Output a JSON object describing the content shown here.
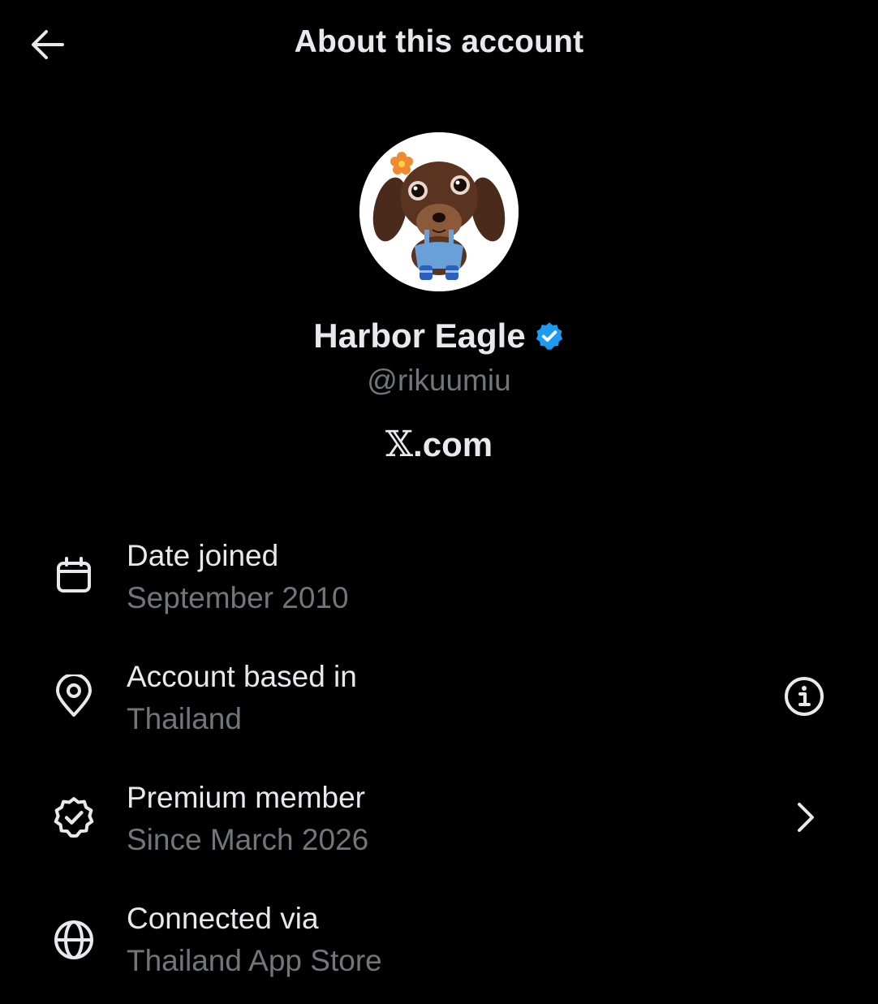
{
  "header": {
    "title": "About this account",
    "back_icon": "arrow-left-icon"
  },
  "profile": {
    "display_name": "Harbor Eagle",
    "verified_icon": "verified-badge-icon",
    "verified_color": "#1d9bf0",
    "handle": "@rikuumiu",
    "domain_letter": "𝕏",
    "domain_suffix": ".com",
    "avatar": "dachshund-puppy-avatar"
  },
  "details": [
    {
      "icon": "calendar-icon",
      "label": "Date joined",
      "value": "September 2010"
    },
    {
      "icon": "location-pin-icon",
      "label": "Account based in",
      "value": "Thailand",
      "action_icon": "info-icon"
    },
    {
      "icon": "verified-outline-icon",
      "label": "Premium member",
      "value": "Since March 2026",
      "action_icon": "chevron-right-icon"
    },
    {
      "icon": "globe-icon",
      "label": "Connected via",
      "value": "Thailand App Store"
    }
  ],
  "colors": {
    "background": "#000000",
    "primary_text": "#e7e9ea",
    "secondary_text": "#71767b",
    "accent": "#1d9bf0"
  }
}
